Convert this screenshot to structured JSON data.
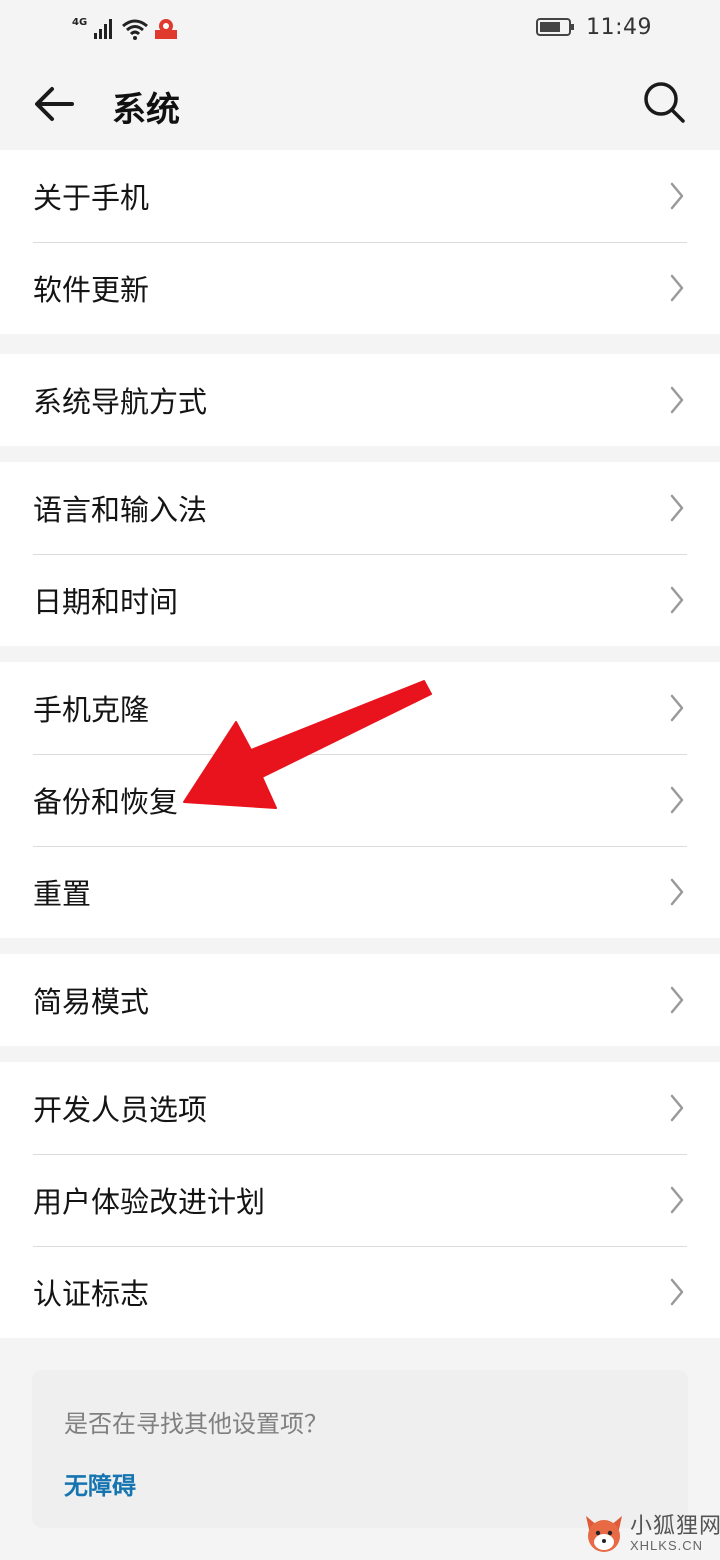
{
  "status_bar": {
    "network": "4G",
    "time": "11:49"
  },
  "header": {
    "title": "系统"
  },
  "groups": [
    {
      "items": [
        {
          "label": "关于手机"
        },
        {
          "label": "软件更新"
        }
      ]
    },
    {
      "items": [
        {
          "label": "系统导航方式"
        }
      ]
    },
    {
      "items": [
        {
          "label": "语言和输入法"
        },
        {
          "label": "日期和时间"
        }
      ]
    },
    {
      "items": [
        {
          "label": "手机克隆"
        },
        {
          "label": "备份和恢复"
        },
        {
          "label": "重置"
        }
      ]
    },
    {
      "items": [
        {
          "label": "简易模式"
        }
      ]
    },
    {
      "items": [
        {
          "label": "开发人员选项"
        },
        {
          "label": "用户体验改进计划"
        },
        {
          "label": "认证标志"
        }
      ]
    }
  ],
  "hint_card": {
    "text": "是否在寻找其他设置项？",
    "link": "无障碍"
  },
  "annotation": {
    "color": "#e8131c",
    "target": "备份和恢复"
  },
  "watermark": {
    "cn": "小狐狸网",
    "en": "XHLKS.CN"
  },
  "colors": {
    "page_background": "#f4f4f4",
    "card_background": "#ffffff",
    "link": "#1675b0"
  }
}
